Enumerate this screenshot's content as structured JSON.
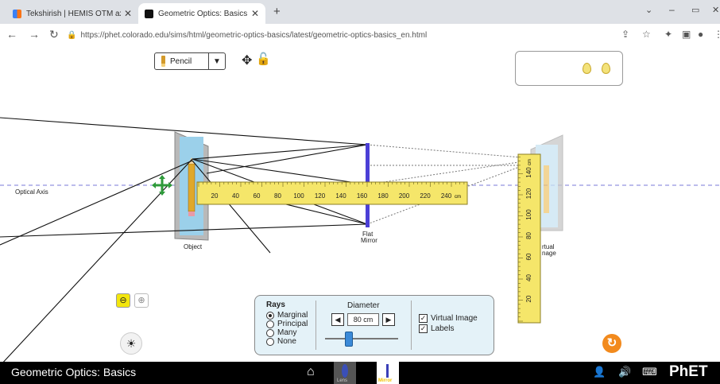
{
  "browser": {
    "tabs": [
      {
        "title": "Tekshirish | HEMIS OTM axborot"
      },
      {
        "title": "Geometric Optics: Basics"
      }
    ],
    "url": "https://phet.colorado.edu/sims/html/geometric-optics-basics/latest/geometric-optics-basics_en.html"
  },
  "toolbar": {
    "object_select": "Pencil"
  },
  "scene": {
    "optical_axis_label": "Optical Axis",
    "object_label": "Object",
    "mirror_label_line1": "Flat",
    "mirror_label_line2": "Mirror",
    "virtual_label_line1": "rtual",
    "virtual_label_line2": "nage",
    "horizontal_ruler_ticks": [
      "20",
      "40",
      "60",
      "80",
      "100",
      "120",
      "140",
      "160",
      "180",
      "200",
      "220",
      "240"
    ],
    "horizontal_ruler_unit": "cm",
    "vertical_ruler_ticks": [
      "20",
      "40",
      "60",
      "80",
      "100",
      "120",
      "140"
    ],
    "vertical_ruler_unit": "cm"
  },
  "controls": {
    "rays_title": "Rays",
    "ray_options": [
      "Marginal",
      "Principal",
      "Many",
      "None"
    ],
    "selected_ray": "Marginal",
    "diameter_title": "Diameter",
    "diameter_value": "80 cm",
    "checkboxes": [
      "Virtual Image",
      "Labels"
    ]
  },
  "bottom_bar": {
    "title": "Geometric Optics: Basics",
    "screen_tabs": [
      "Lens",
      "Mirror"
    ],
    "brand": "PhET"
  },
  "colors": {
    "mirror": "#4b3fd6",
    "ruler": "#f5e66a",
    "zoom_button": "#f3e60d",
    "reset": "#f28a1d"
  }
}
